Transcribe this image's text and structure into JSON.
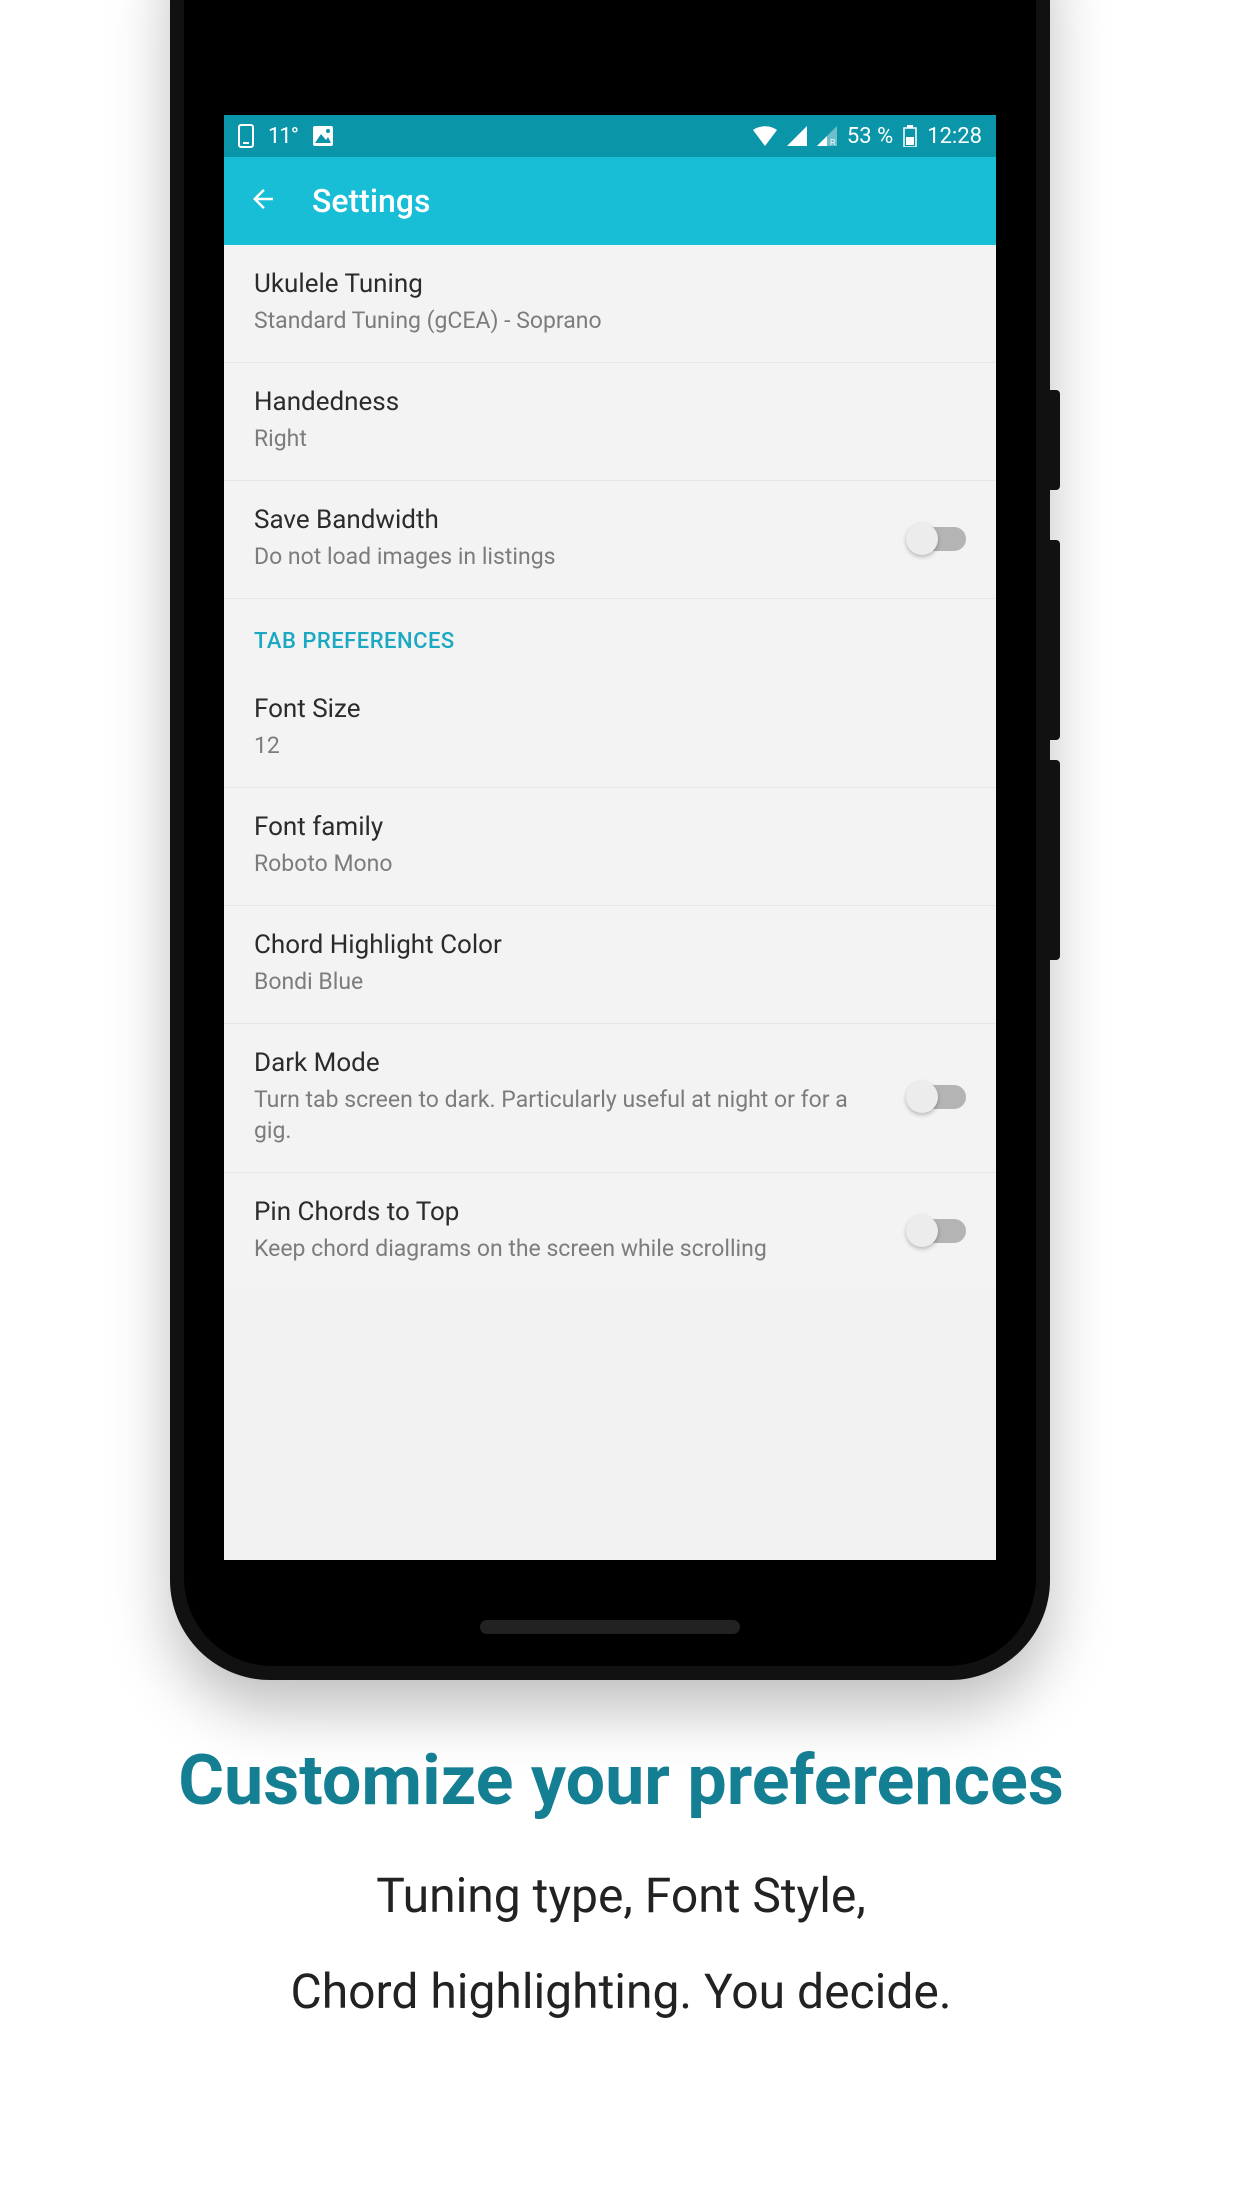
{
  "status": {
    "temp": "11°",
    "battery_pct": "53 %",
    "time": "12:28"
  },
  "appbar": {
    "title": "Settings"
  },
  "rows": {
    "tuning": {
      "title": "Ukulele Tuning",
      "sub": "Standard Tuning (gCEA) - Soprano"
    },
    "handedness": {
      "title": "Handedness",
      "sub": "Right"
    },
    "bandwidth": {
      "title": "Save Bandwidth",
      "sub": "Do not load images in listings"
    },
    "section_tab": "TAB PREFERENCES",
    "fontsize": {
      "title": "Font Size",
      "sub": "12"
    },
    "fontfamily": {
      "title": "Font family",
      "sub": "Roboto Mono"
    },
    "chordcolor": {
      "title": "Chord Highlight Color",
      "sub": "Bondi Blue"
    },
    "darkmode": {
      "title": "Dark Mode",
      "sub": "Turn tab screen to dark. Particularly useful at night or for a gig."
    },
    "pinchords": {
      "title": "Pin Chords to Top",
      "sub": "Keep chord diagrams on the screen while scrolling"
    }
  },
  "marketing": {
    "headline": "Customize your preferences",
    "line1": "Tuning type, Font Style,",
    "line2": "Chord highlighting. You decide."
  }
}
